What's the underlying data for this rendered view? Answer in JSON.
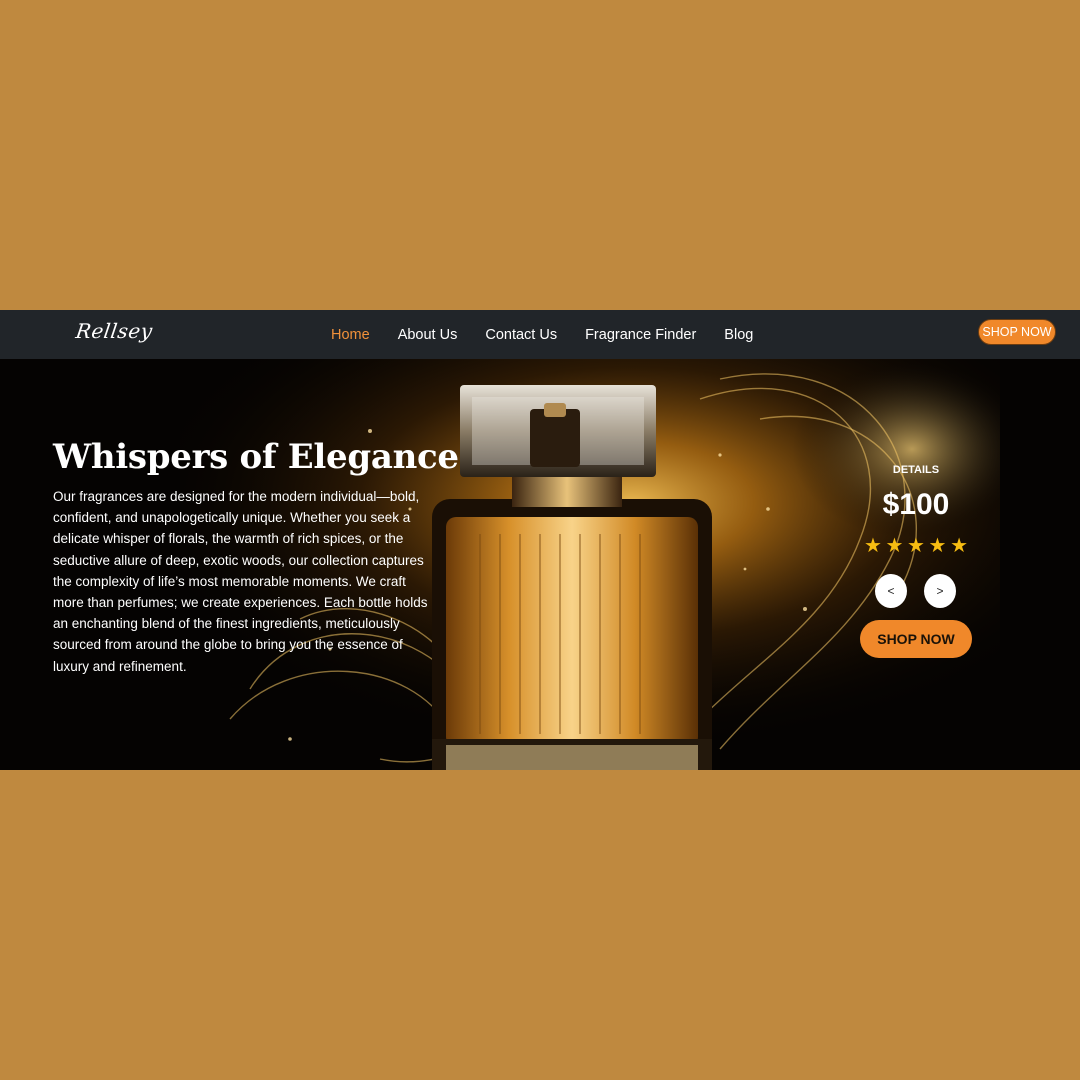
{
  "brand": {
    "logo_text": "Rellsey"
  },
  "navbar": {
    "links": [
      {
        "label": "Home",
        "active": true
      },
      {
        "label": "About Us",
        "active": false
      },
      {
        "label": "Contact Us",
        "active": false
      },
      {
        "label": "Fragrance Finder",
        "active": false
      },
      {
        "label": "Blog",
        "active": false
      }
    ],
    "shop_label": "SHOP NOW"
  },
  "hero": {
    "title": "Whispers of Elegance",
    "body": "Our fragrances are designed for the modern individual—bold, confident, and unapologetically unique. Whether you seek a delicate whisper of florals, the warmth of rich spices, or the seductive allure of deep, exotic woods, our collection captures the complexity of life’s most memorable moments. We craft more than perfumes; we create experiences. Each bottle holds an enchanting blend of the finest ingredients, meticulously sourced from around the globe to bring you the essence of luxury and refinement.",
    "image_icon": "perfume-bottle-image"
  },
  "details": {
    "label": "DETAILS",
    "price": "$100",
    "rating": 5,
    "rating_max": 5,
    "star_glyph": "★",
    "prev_label": "<",
    "next_label": ">",
    "shop_label": "SHOP NOW"
  },
  "colors": {
    "page_background": "#bf893f",
    "navbar_background": "#212529",
    "accent": "#f0882a",
    "active_link": "#f0913a",
    "star": "#f7bd12",
    "hero_background": "#050302"
  }
}
